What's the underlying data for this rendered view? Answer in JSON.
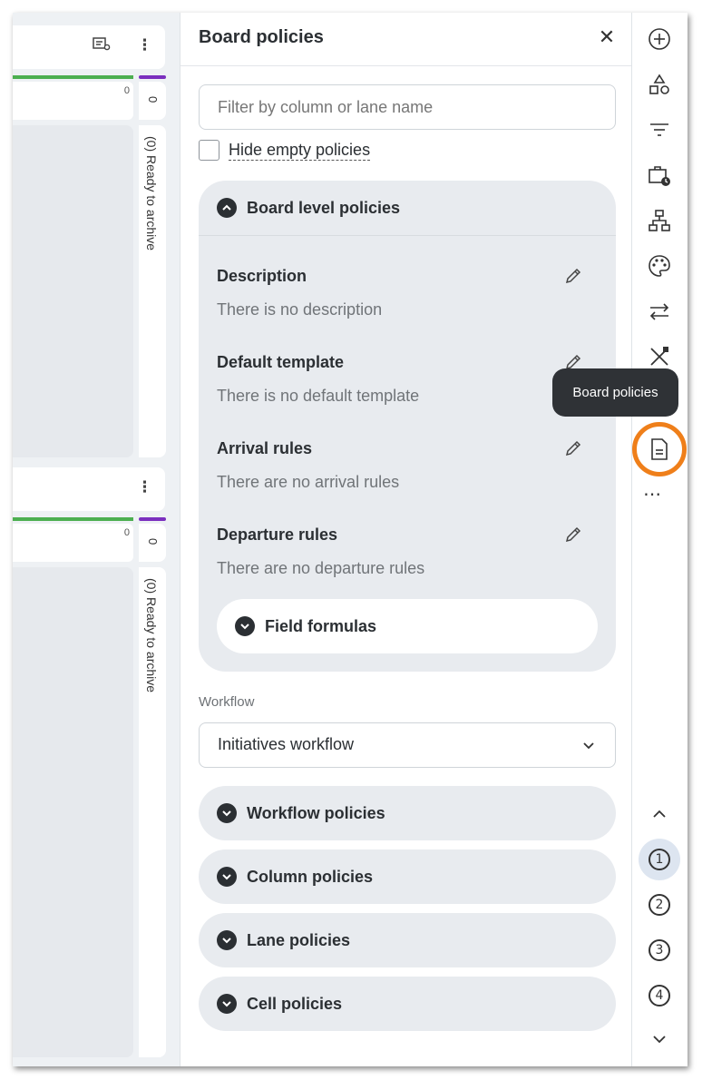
{
  "panel": {
    "title": "Board policies",
    "close_icon": "close-icon",
    "filter_placeholder": "Filter by column or lane name",
    "hide_empty_label": "Hide empty policies",
    "hide_empty_checked": false
  },
  "board_level": {
    "title": "Board level policies",
    "expanded": true,
    "policies": [
      {
        "name": "Description",
        "value": "There is no description"
      },
      {
        "name": "Default template",
        "value": "There is no default template"
      },
      {
        "name": "Arrival rules",
        "value": "There are no arrival rules"
      },
      {
        "name": "Departure rules",
        "value": "There are no departure rules"
      }
    ],
    "field_formulas": "Field formulas"
  },
  "workflow": {
    "label": "Workflow",
    "selected": "Initiatives workflow"
  },
  "sections": [
    {
      "title": "Workflow policies"
    },
    {
      "title": "Column policies"
    },
    {
      "title": "Lane policies"
    },
    {
      "title": "Cell policies"
    }
  ],
  "board": {
    "lanes": [
      {
        "count": "0",
        "archive_count": "0",
        "archive_label": "(0) Ready to archive"
      },
      {
        "count": "0",
        "archive_count": "0",
        "archive_label": "(0) Ready to archive"
      }
    ],
    "colors": {
      "green": "#4caf50",
      "purple": "#7b2fbe"
    }
  },
  "toolbar": {
    "tooltip": "Board policies",
    "icons": [
      "add-icon",
      "shapes-icon",
      "filter-icon",
      "briefcase-clock-icon",
      "hierarchy-icon",
      "palette-icon",
      "swap-arrows-icon",
      "tools-icon",
      "board-policies-icon",
      "more-icon"
    ],
    "levels": [
      "1",
      "2",
      "3",
      "4"
    ],
    "active_level": "1",
    "highlight_color": "#ef7f1a"
  }
}
